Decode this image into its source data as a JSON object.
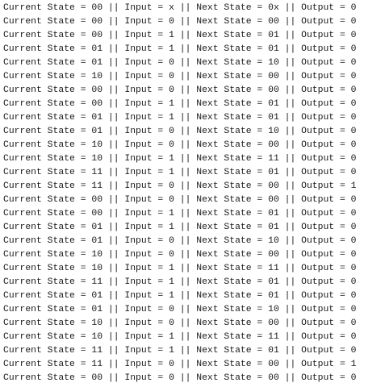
{
  "console": {
    "lines": [
      "Current State = 00 || Input = x || Next State = 0x || Output = 0",
      "Current State = 00 || Input = 0 || Next State = 00 || Output = 0",
      "Current State = 00 || Input = 1 || Next State = 01 || Output = 0",
      "Current State = 01 || Input = 1 || Next State = 01 || Output = 0",
      "Current State = 01 || Input = 0 || Next State = 10 || Output = 0",
      "Current State = 10 || Input = 0 || Next State = 00 || Output = 0",
      "Current State = 00 || Input = 0 || Next State = 00 || Output = 0",
      "Current State = 00 || Input = 1 || Next State = 01 || Output = 0",
      "Current State = 01 || Input = 1 || Next State = 01 || Output = 0",
      "Current State = 01 || Input = 0 || Next State = 10 || Output = 0",
      "Current State = 10 || Input = 0 || Next State = 00 || Output = 0",
      "Current State = 10 || Input = 1 || Next State = 11 || Output = 0",
      "Current State = 11 || Input = 1 || Next State = 01 || Output = 0",
      "Current State = 11 || Input = 0 || Next State = 00 || Output = 1",
      "Current State = 00 || Input = 0 || Next State = 00 || Output = 0",
      "Current State = 00 || Input = 1 || Next State = 01 || Output = 0",
      "Current State = 01 || Input = 1 || Next State = 01 || Output = 0",
      "Current State = 01 || Input = 0 || Next State = 10 || Output = 0",
      "Current State = 10 || Input = 0 || Next State = 00 || Output = 0",
      "Current State = 10 || Input = 1 || Next State = 11 || Output = 0",
      "Current State = 11 || Input = 1 || Next State = 01 || Output = 0",
      "Current State = 01 || Input = 1 || Next State = 01 || Output = 0",
      "Current State = 01 || Input = 0 || Next State = 10 || Output = 0",
      "Current State = 10 || Input = 0 || Next State = 00 || Output = 0",
      "Current State = 10 || Input = 1 || Next State = 11 || Output = 0",
      "Current State = 11 || Input = 1 || Next State = 01 || Output = 0",
      "Current State = 11 || Input = 0 || Next State = 00 || Output = 1",
      "Current State = 00 || Input = 0 || Next State = 00 || Output = 0"
    ]
  }
}
